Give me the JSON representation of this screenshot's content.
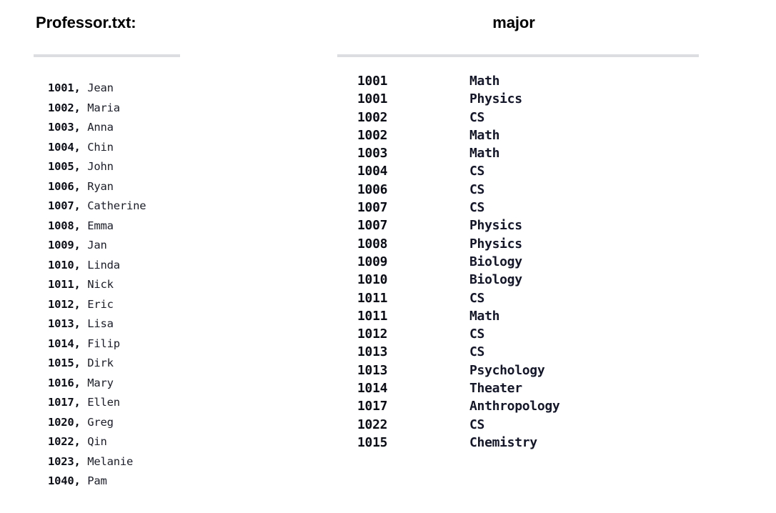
{
  "left": {
    "title": "Professor.txt:",
    "rows": [
      {
        "id": "1001",
        "sep": ", ",
        "name": "Jean"
      },
      {
        "id": "1002",
        "sep": ", ",
        "name": "Maria"
      },
      {
        "id": "1003",
        "sep": ", ",
        "name": "Anna"
      },
      {
        "id": "1004",
        "sep": ", ",
        "name": "Chin"
      },
      {
        "id": "1005",
        "sep": ", ",
        "name": "John"
      },
      {
        "id": "1006",
        "sep": ", ",
        "name": "Ryan"
      },
      {
        "id": "1007",
        "sep": ", ",
        "name": "Catherine"
      },
      {
        "id": "1008",
        "sep": ", ",
        "name": "Emma"
      },
      {
        "id": "1009",
        "sep": ", ",
        "name": "Jan"
      },
      {
        "id": "1010",
        "sep": ", ",
        "name": "Linda"
      },
      {
        "id": "1011",
        "sep": ", ",
        "name": "Nick"
      },
      {
        "id": "1012",
        "sep": ", ",
        "name": "Eric"
      },
      {
        "id": "1013",
        "sep": ", ",
        "name": "Lisa"
      },
      {
        "id": "1014",
        "sep": ", ",
        "name": "Filip"
      },
      {
        "id": "1015",
        "sep": ", ",
        "name": "Dirk"
      },
      {
        "id": "1016",
        "sep": ", ",
        "name": "Mary"
      },
      {
        "id": "1017",
        "sep": ", ",
        "name": "Ellen"
      },
      {
        "id": "1020",
        "sep": ", ",
        "name": "Greg"
      },
      {
        "id": "1022",
        "sep": ", ",
        "name": "Qin"
      },
      {
        "id": "1023",
        "sep": ", ",
        "name": "Melanie"
      },
      {
        "id": "1040",
        "sep": ", ",
        "name": "Pam"
      }
    ]
  },
  "right": {
    "title": "major",
    "rows": [
      {
        "id": "1001",
        "major": "Math"
      },
      {
        "id": "1001",
        "major": "Physics"
      },
      {
        "id": "1002",
        "major": "CS"
      },
      {
        "id": "1002",
        "major": "Math"
      },
      {
        "id": "1003",
        "major": "Math"
      },
      {
        "id": "1004",
        "major": "CS"
      },
      {
        "id": "1006",
        "major": "CS"
      },
      {
        "id": "1007",
        "major": "CS"
      },
      {
        "id": "1007",
        "major": "Physics"
      },
      {
        "id": "1008",
        "major": "Physics"
      },
      {
        "id": "1009",
        "major": "Biology"
      },
      {
        "id": "1010",
        "major": "Biology"
      },
      {
        "id": "1011",
        "major": "CS"
      },
      {
        "id": "1011",
        "major": "Math"
      },
      {
        "id": "1012",
        "major": "CS"
      },
      {
        "id": "1013",
        "major": "CS"
      },
      {
        "id": "1013",
        "major": "Psychology"
      },
      {
        "id": "1014",
        "major": "Theater"
      },
      {
        "id": "1017",
        "major": "Anthropology"
      },
      {
        "id": "1022",
        "major": "CS"
      },
      {
        "id": "1015",
        "major": "Chemistry"
      }
    ]
  },
  "colors": {
    "text": "#101320",
    "rule": "#dcdde0",
    "background": "#ffffff"
  }
}
